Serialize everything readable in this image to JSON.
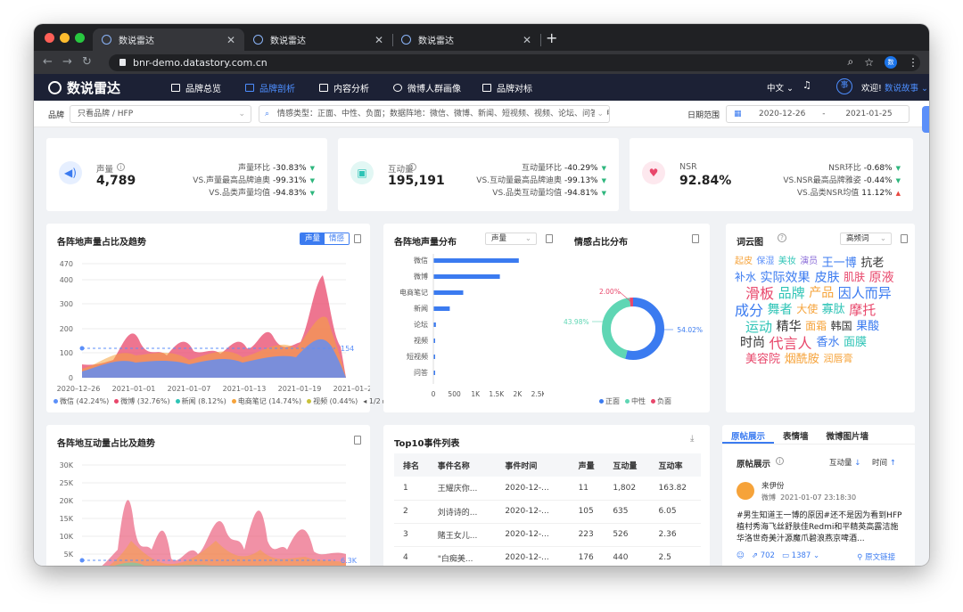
{
  "browser": {
    "tabs": [
      "数说雷达",
      "数说雷达",
      "数说雷达"
    ],
    "url": "bnr-demo.datastory.com.cn",
    "profile": "数"
  },
  "app": {
    "logo": "数说雷达",
    "nav": [
      "品牌总览",
      "品牌剖析",
      "内容分析",
      "微博人群画像",
      "品牌对标"
    ],
    "active_nav": "品牌剖析",
    "lang": "中文 ⌄",
    "badge": "事",
    "welcome": "欢迎!",
    "user": "数说故事 ⌄"
  },
  "filters": {
    "brand_label": "品牌",
    "brand_value": "只看品牌 / HFP",
    "query": "情感类型：正面、中性、负面；数据阵地：微信、微博、新闻、短视频、视频、论坛、问答、电...",
    "date_label": "日期范围",
    "date_start": "2020-12-26",
    "date_sep": "-",
    "date_end": "2021-01-25"
  },
  "kpis": [
    {
      "title": "声量",
      "value": "4,789",
      "icon": "speaker-icon",
      "color": "#3b7bf0",
      "bg": "#e6efff",
      "rows": [
        {
          "label": "声量环比",
          "val": "-30.83%",
          "dir": "down"
        },
        {
          "label": "VS.声量最高品牌迪奥",
          "val": "-99.31%",
          "dir": "down"
        },
        {
          "label": "VS.品类声量均值",
          "val": "-94.83%",
          "dir": "down"
        }
      ]
    },
    {
      "title": "互动量",
      "value": "195,191",
      "icon": "chat-icon",
      "color": "#2ec4b6",
      "bg": "#e2f7f4",
      "rows": [
        {
          "label": "互动量环比",
          "val": "-40.29%",
          "dir": "down"
        },
        {
          "label": "VS.互动量最高品牌迪奥",
          "val": "-99.13%",
          "dir": "down"
        },
        {
          "label": "VS.品类互动量均值",
          "val": "-94.81%",
          "dir": "down"
        }
      ]
    },
    {
      "title": "NSR",
      "value": "92.84%",
      "icon": "heart-icon",
      "color": "#e8476b",
      "bg": "#fde8ee",
      "rows": [
        {
          "label": "NSR环比",
          "val": "-0.68%",
          "dir": "down"
        },
        {
          "label": "VS.NSR最高品牌雅姿",
          "val": "-0.44%",
          "dir": "down"
        },
        {
          "label": "VS.品类NSR均值",
          "val": "11.12%",
          "dir": "up"
        }
      ]
    }
  ],
  "trend": {
    "title": "各阵地声量占比及趋势",
    "toggle": [
      "声量",
      "情感"
    ],
    "y_ticks": [
      "470",
      "400",
      "300",
      "200",
      "100",
      "0"
    ],
    "x_ticks": [
      "2020–12–26",
      "2021–01–01",
      "2021–01–07",
      "2021–01–13",
      "2021–01–19",
      "2021–01–25"
    ],
    "avg_label": "154",
    "legend": [
      {
        "name": "微信 (42.24%)",
        "color": "#5b8ff9"
      },
      {
        "name": "微博 (32.76%)",
        "color": "#e8476b"
      },
      {
        "name": "新闻 (8.12%)",
        "color": "#2ec4b6"
      },
      {
        "name": "电商笔记 (14.74%)",
        "color": "#f6a33a"
      },
      {
        "name": "视频 (0.44%)",
        "color": "#c9c13a"
      }
    ],
    "pager": "◂ 1/2 ▸"
  },
  "distribution": {
    "title": "各阵地声量分布",
    "select": "声量",
    "chart_data": {
      "type": "bar",
      "categories": [
        "微信",
        "微博",
        "电商笔记",
        "新闻",
        "论坛",
        "视频",
        "短视频",
        "问答"
      ],
      "values": [
        2030,
        1580,
        710,
        390,
        60,
        25,
        15,
        8
      ],
      "xlim": [
        0,
        2500
      ],
      "x_ticks": [
        "0",
        "500",
        "1K",
        "1.5K",
        "2K",
        "2.5K"
      ]
    }
  },
  "sentiment": {
    "title": "情感占比分布",
    "chart_data": {
      "type": "pie",
      "labels": [
        "正面",
        "中性",
        "负面"
      ],
      "values": [
        54.02,
        43.98,
        2.0
      ],
      "value_labels": [
        "54.02%",
        "43.98%",
        "2.00%"
      ]
    },
    "legend": [
      {
        "name": "正面",
        "color": "#3b7bf0"
      },
      {
        "name": "中性",
        "color": "#5fd6b4"
      },
      {
        "name": "负面",
        "color": "#e8476b"
      }
    ]
  },
  "cloud": {
    "title": "词云图",
    "select": "高频词",
    "words": [
      {
        "t": "起皮",
        "c": "#f6a33a",
        "s": 10
      },
      {
        "t": "保湿",
        "c": "#5b8ff9",
        "s": 10
      },
      {
        "t": "美妆",
        "c": "#2ec4b6",
        "s": 10
      },
      {
        "t": "演员",
        "c": "#8a6cd8",
        "s": 10
      },
      {
        "t": "王一博",
        "c": "#3b7bf0",
        "s": 13
      },
      {
        "t": "抗老",
        "c": "#333",
        "s": 13
      },
      {
        "t": "补水",
        "c": "#3b7bf0",
        "s": 12
      },
      {
        "t": "实际效果",
        "c": "#3b7bf0",
        "s": 14
      },
      {
        "t": "皮肤",
        "c": "#3b7bf0",
        "s": 14
      },
      {
        "t": "肌肤",
        "c": "#e8476b",
        "s": 12
      },
      {
        "t": "原液",
        "c": "#e8476b",
        "s": 14
      },
      {
        "t": "滑板",
        "c": "#e8476b",
        "s": 16
      },
      {
        "t": "品牌",
        "c": "#2ec4b6",
        "s": 15
      },
      {
        "t": "产品",
        "c": "#f6a33a",
        "s": 14
      },
      {
        "t": "因人而异",
        "c": "#3b7bf0",
        "s": 15
      },
      {
        "t": "成分",
        "c": "#3b7bf0",
        "s": 16
      },
      {
        "t": "舞者",
        "c": "#2ec4b6",
        "s": 14
      },
      {
        "t": "大使",
        "c": "#f6a33a",
        "s": 12
      },
      {
        "t": "寡肽",
        "c": "#2ec4b6",
        "s": 13
      },
      {
        "t": "摩托",
        "c": "#e8476b",
        "s": 15
      },
      {
        "t": "运动",
        "c": "#2ec4b6",
        "s": 15
      },
      {
        "t": "精华",
        "c": "#333",
        "s": 14
      },
      {
        "t": "面霜",
        "c": "#f6a33a",
        "s": 12
      },
      {
        "t": "韩国",
        "c": "#333",
        "s": 12
      },
      {
        "t": "果酸",
        "c": "#3b7bf0",
        "s": 13
      },
      {
        "t": "时尚",
        "c": "#333",
        "s": 14
      },
      {
        "t": "代言人",
        "c": "#e8476b",
        "s": 16
      },
      {
        "t": "香水",
        "c": "#3b7bf0",
        "s": 13
      },
      {
        "t": "面膜",
        "c": "#2ec4b6",
        "s": 13
      },
      {
        "t": "美容院",
        "c": "#e8476b",
        "s": 13
      },
      {
        "t": "烟酰胺",
        "c": "#f6a33a",
        "s": 13
      },
      {
        "t": "润唇膏",
        "c": "#f6a33a",
        "s": 11
      }
    ]
  },
  "interaction_trend": {
    "title": "各阵地互动量占比及趋势",
    "y_ticks": [
      "30K",
      "25K",
      "20K",
      "15K",
      "10K",
      "5K"
    ],
    "avg_label": "6.3K"
  },
  "top10": {
    "title": "Top10事件列表",
    "headers": [
      "排名",
      "事件名称",
      "事件时间",
      "声量",
      "互动量",
      "互动率"
    ],
    "rows": [
      [
        "1",
        "王耀庆你...",
        "2020-12-...",
        "11",
        "1,802",
        "163.82"
      ],
      [
        "2",
        "刘诗诗的...",
        "2020-12-...",
        "105",
        "635",
        "6.05"
      ],
      [
        "3",
        "賭王女儿...",
        "2020-12-...",
        "223",
        "526",
        "2.36"
      ],
      [
        "4",
        "\"白痴美...",
        "2020-12-...",
        "176",
        "440",
        "2.5"
      ]
    ]
  },
  "posts": {
    "tabs": [
      "原帖展示",
      "表情墙",
      "微博图片墙"
    ],
    "section": "原帖展示",
    "sort1": "互动量",
    "sort2": "时间",
    "author": "来伊份",
    "platform": "微博",
    "time": "2021-01-07 23:18:30",
    "content": "#男生知道王一博的原因#还不是因为看到HFP植村秀海飞丝舒肤佳Redmi和平精英高露洁施华洛世奇美汁源魔爪碧浪燕京啤酒...",
    "reposts": "702",
    "comments": "1387",
    "link": "原文链接"
  }
}
